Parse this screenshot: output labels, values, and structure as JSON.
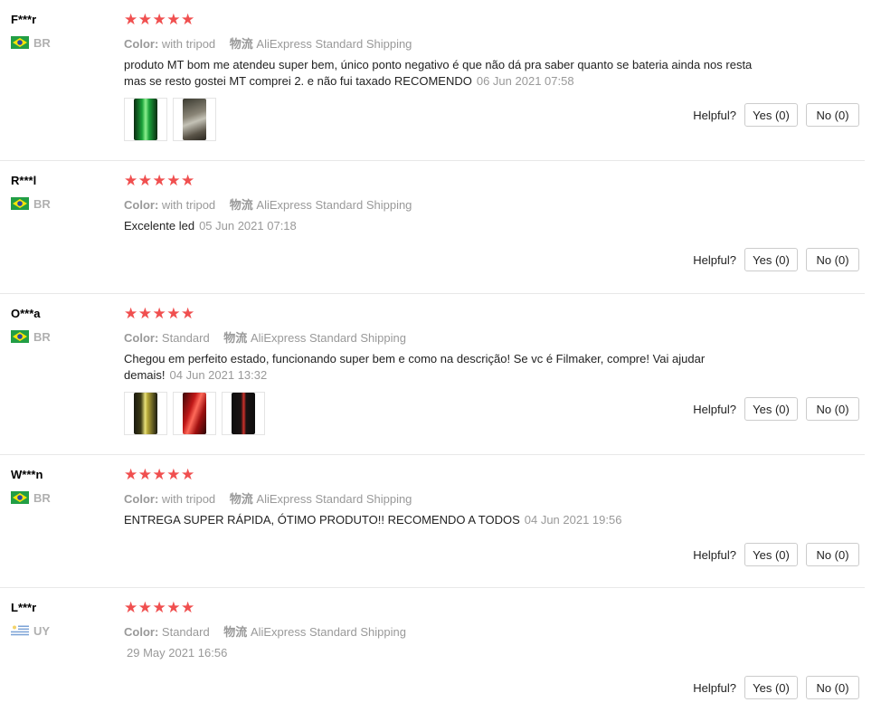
{
  "reviews": [
    {
      "user": "F***r",
      "country": "BR",
      "rating": "★★★★★",
      "color_label": "Color:",
      "color_value": "with tripod",
      "shipping_label": "物流",
      "shipping_value": "AliExpress Standard Shipping",
      "text": "produto MT bom me atendeu super bem, único ponto negativo é que não dá pra saber quanto se bateria ainda nos resta mas se resto gostei MT comprei 2. e não fui taxado RECOMENDO",
      "date": "06 Jun 2021 07:58",
      "helpful_label": "Helpful?",
      "yes_label": "Yes (0)",
      "no_label": "No (0)"
    },
    {
      "user": "R***l",
      "country": "BR",
      "rating": "★★★★★",
      "color_label": "Color:",
      "color_value": "with tripod",
      "shipping_label": "物流",
      "shipping_value": "AliExpress Standard Shipping",
      "text": "Excelente led",
      "date": "05 Jun 2021 07:18",
      "helpful_label": "Helpful?",
      "yes_label": "Yes (0)",
      "no_label": "No (0)"
    },
    {
      "user": "O***a",
      "country": "BR",
      "rating": "★★★★★",
      "color_label": "Color:",
      "color_value": "Standard",
      "shipping_label": "物流",
      "shipping_value": "AliExpress Standard Shipping",
      "text": "Chegou em perfeito estado, funcionando super bem e como na descrição! Se vc é Filmaker, compre! Vai ajudar demais!",
      "date": "04 Jun 2021 13:32",
      "helpful_label": "Helpful?",
      "yes_label": "Yes (0)",
      "no_label": "No (0)"
    },
    {
      "user": "W***n",
      "country": "BR",
      "rating": "★★★★★",
      "color_label": "Color:",
      "color_value": "with tripod",
      "shipping_label": "物流",
      "shipping_value": "AliExpress Standard Shipping",
      "text": "ENTREGA SUPER RÁPIDA, ÓTIMO PRODUTO!! RECOMENDO A TODOS",
      "date": "04 Jun 2021 19:56",
      "helpful_label": "Helpful?",
      "yes_label": "Yes (0)",
      "no_label": "No (0)"
    },
    {
      "user": "L***r",
      "country": "UY",
      "rating": "★★★★★",
      "color_label": "Color:",
      "color_value": "Standard",
      "shipping_label": "物流",
      "shipping_value": "AliExpress Standard Shipping",
      "text": "",
      "date": "29 May 2021 16:56",
      "helpful_label": "Helpful?",
      "yes_label": "Yes (0)",
      "no_label": "No (0)"
    }
  ]
}
